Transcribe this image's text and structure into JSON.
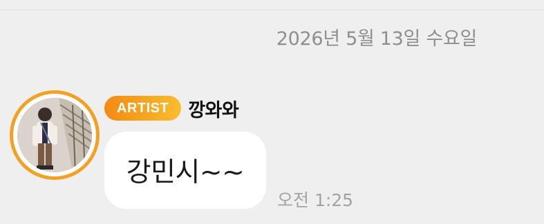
{
  "chat": {
    "date_separator": "2026년 5월 13일 수요일",
    "message": {
      "badge": "ARTIST",
      "sender_name": "깡와와",
      "text": "강민시~~",
      "time": "오전 1:25",
      "avatar_icon": "profile-photo",
      "colors": {
        "avatar_ring": "#f2a122",
        "badge_gradient_start": "#f28a12",
        "badge_gradient_end": "#fbbd2d",
        "bubble_background": "#ffffff",
        "chat_background": "#efefef"
      }
    }
  }
}
